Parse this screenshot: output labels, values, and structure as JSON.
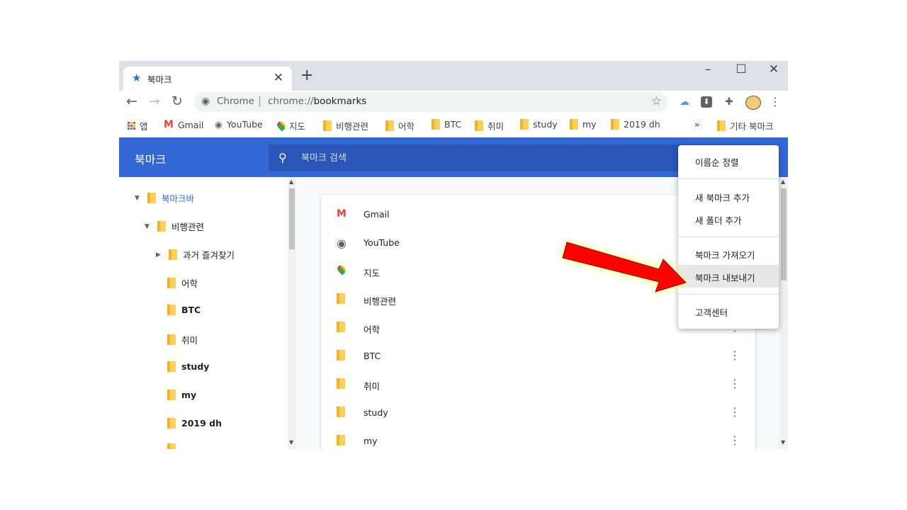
{
  "browser": {
    "tab_title": "북마크",
    "new_tab": "+",
    "window_controls": {
      "minimize": "–",
      "maximize": "☐",
      "close": "✕"
    },
    "tab_close": "✕",
    "nav": {
      "back": "←",
      "forward": "→",
      "reload": "↻"
    },
    "omnibox": {
      "chip": "Chrome",
      "separator": "|",
      "url_prefix": "chrome://",
      "url_path": "bookmarks",
      "star": "☆"
    },
    "menu_dots": "⋮"
  },
  "bookmarks_bar": {
    "items": [
      {
        "label": "앱",
        "icon": "apps-icon"
      },
      {
        "label": "Gmail",
        "icon": "gmail-icon"
      },
      {
        "label": "YouTube",
        "icon": "globe-icon"
      },
      {
        "label": "지도",
        "icon": "maps-icon"
      },
      {
        "label": "비행관련",
        "icon": "folder-icon"
      },
      {
        "label": "어학",
        "icon": "folder-icon"
      },
      {
        "label": "BTC",
        "icon": "folder-icon"
      },
      {
        "label": "취미",
        "icon": "folder-icon"
      },
      {
        "label": "study",
        "icon": "folder-icon"
      },
      {
        "label": "my",
        "icon": "folder-icon"
      },
      {
        "label": "2019 dh",
        "icon": "folder-icon"
      }
    ],
    "overflow": "»",
    "other_bookmarks": "기타 북마크"
  },
  "header": {
    "title": "북마크",
    "search_placeholder": "북마크 검색"
  },
  "sidebar": {
    "items": [
      {
        "label": "북마크바",
        "bold": false,
        "selected": true
      },
      {
        "label": "비행관련",
        "bold": false
      },
      {
        "label": "과거 즐겨찾기",
        "bold": false
      },
      {
        "label": "어학",
        "bold": false
      },
      {
        "label": "BTC",
        "bold": true
      },
      {
        "label": "취미",
        "bold": false
      },
      {
        "label": "study",
        "bold": true
      },
      {
        "label": "my",
        "bold": true
      },
      {
        "label": "2019 dh",
        "bold": true
      }
    ]
  },
  "list": {
    "rows": [
      {
        "label": "Gmail",
        "icon": "gmail-icon"
      },
      {
        "label": "YouTube",
        "icon": "globe-icon"
      },
      {
        "label": "지도",
        "icon": "maps-icon"
      },
      {
        "label": "비행관련",
        "icon": "folder-icon"
      },
      {
        "label": "어학",
        "icon": "folder-icon"
      },
      {
        "label": "BTC",
        "icon": "folder-icon"
      },
      {
        "label": "취미",
        "icon": "folder-icon"
      },
      {
        "label": "study",
        "icon": "folder-icon"
      },
      {
        "label": "my",
        "icon": "folder-icon"
      }
    ],
    "more_glyph": "⋮"
  },
  "menu": {
    "sort": "이름순 정렬",
    "add_bookmark": "새 북마크 추가",
    "add_folder": "새 폴더 추가",
    "import": "북마크 가져오기",
    "export": "북마크 내보내기",
    "help": "고객센터",
    "highlighted": "export"
  },
  "annotation": {
    "arrow_color": "#ff0000",
    "glow_color": "#ffff66"
  },
  "colors": {
    "accent": "#3367d6",
    "folder": "#fcd05a"
  }
}
